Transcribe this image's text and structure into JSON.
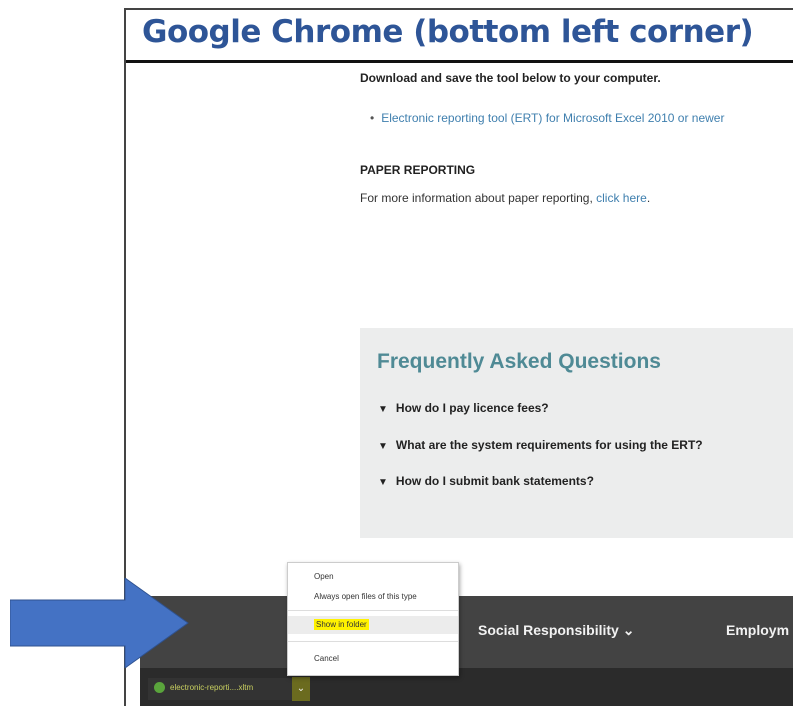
{
  "slide_title": "Google Chrome (bottom left corner)",
  "page": {
    "intro": "Download and save the tool below to your computer.",
    "link_item": "Electronic reporting tool (ERT) for Microsoft Excel 2010 or newer",
    "section_heading": "PAPER REPORTING",
    "info_text": "For more information about paper reporting, ",
    "info_link": "click here",
    "info_end": "."
  },
  "faq": {
    "title": "Frequently Asked Questions",
    "questions": [
      "How do I pay licence fees?",
      "What are the system requirements for using the ERT?",
      "How do I submit bank statements?"
    ]
  },
  "navbar": {
    "items": [
      "Social Responsibility ⌄",
      "Employm"
    ]
  },
  "download": {
    "filename": "electronic-reporti....xltm",
    "icon": "excel-file-icon",
    "arrow_icon": "chevron-down-icon"
  },
  "context_menu": {
    "items": [
      "Open",
      "Always open files of this type",
      "Show in folder",
      "Cancel"
    ],
    "highlighted": "Show in folder",
    "highlight_color": "#fff200"
  },
  "colors": {
    "title": "#2e5597",
    "link": "#3f7fae",
    "faq_heading": "#4f8a95",
    "arrow": "#4472c4"
  }
}
